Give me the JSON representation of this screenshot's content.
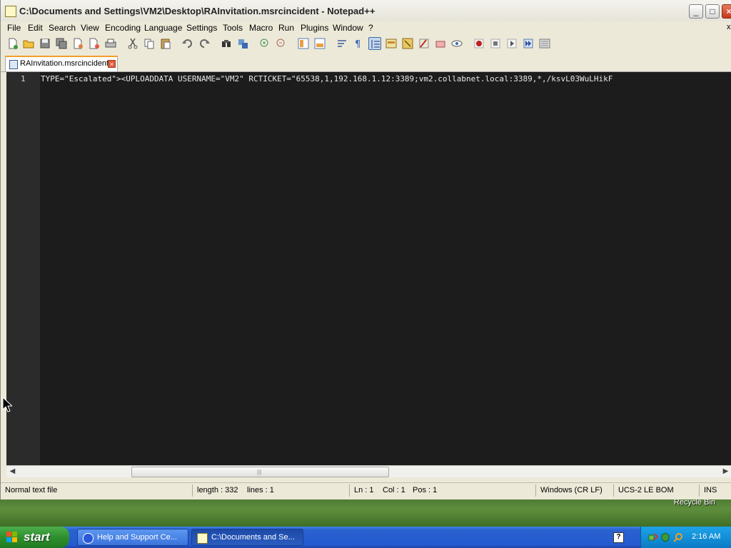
{
  "window": {
    "title": "C:\\Documents and Settings\\VM2\\Desktop\\RAInvitation.msrcincident - Notepad++",
    "min_label": "_",
    "max_label": "□",
    "close_label": "×"
  },
  "menu": {
    "items": [
      "File",
      "Edit",
      "Search",
      "View",
      "Encoding",
      "Language",
      "Settings",
      "Tools",
      "Macro",
      "Run",
      "Plugins",
      "Window",
      "?"
    ],
    "close_label": "x"
  },
  "toolbar": {
    "icons": [
      "new-file-icon",
      "open-file-icon",
      "save-icon",
      "save-all-icon",
      "close-icon",
      "close-all-icon",
      "print-icon",
      "cut-icon",
      "copy-icon",
      "paste-icon",
      "undo-icon",
      "redo-icon",
      "find-icon",
      "replace-icon",
      "zoom-in-icon",
      "zoom-out-icon",
      "sync-vertical-icon",
      "sync-horizontal-icon",
      "word-wrap-icon",
      "show-all-chars-icon",
      "indent-guide-icon",
      "user-language-icon",
      "doc-map-icon",
      "function-list-icon",
      "folder-workspace-icon",
      "monitoring-icon",
      "record-macro-icon",
      "stop-macro-icon",
      "play-macro-icon",
      "run-macro-multiple-icon",
      "save-macro-icon"
    ]
  },
  "tab": {
    "label": "RAInvitation.msrcincident",
    "close_label": "×"
  },
  "editor": {
    "line_number": "1",
    "line_text": "TYPE=\"Escalated\"><UPLOADDATA USERNAME=\"VM2\" RCTICKET=\"65538,1,192.168.1.12:3389;vm2.collabnet.local:3389,*,/ksvL03WuLHikF"
  },
  "scrollbar": {
    "left_arrow": "◀",
    "right_arrow": "▶",
    "grip": "|||",
    "position_fraction": 0.18
  },
  "status": {
    "file_type": "Normal text file",
    "length": "length : 332",
    "lines": "lines : 1",
    "ln": "Ln : 1",
    "col": "Col : 1",
    "pos": "Pos : 1",
    "eol": "Windows (CR LF)",
    "encoding": "UCS-2 LE BOM",
    "mode": "INS"
  },
  "desktop": {
    "recycle_label": "Recycle Bin"
  },
  "taskbar": {
    "start_label": "start",
    "tasks": [
      {
        "label": "Help and Support Ce..."
      },
      {
        "label": "C:\\Documents and Se..."
      }
    ],
    "help_glyph": "?",
    "clock": "2:16 AM"
  },
  "colors": {
    "editor_bg": "#1c1c1c",
    "gutter_bg": "#2b2b2b",
    "tab_accent": "#f29f2a",
    "taskbar_blue": "#245ad0",
    "start_green": "#2f8f2f"
  }
}
